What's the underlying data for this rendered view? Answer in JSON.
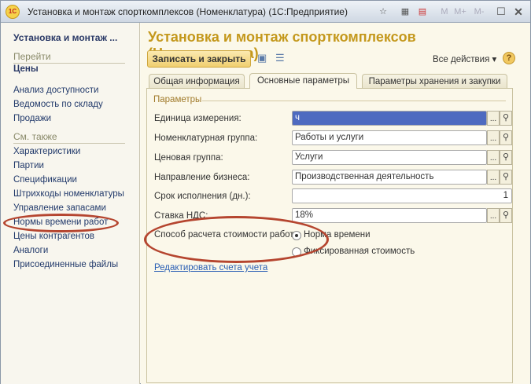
{
  "window": {
    "title": "Установка и монтаж спорткомплексов (Номенклатура)  (1С:Предприятие)",
    "logo": "1С",
    "toolbar": [
      "M",
      "M+",
      "M-"
    ]
  },
  "sidebar": {
    "title": "Установка и монтаж ...",
    "goto_label": "Перейти",
    "goto_current": "Цены",
    "goto_items": [
      "Анализ доступности",
      "Ведомость по складу",
      "Продажи"
    ],
    "see_also_label": "См. также",
    "see_also_items": [
      "Характеристики",
      "Партии",
      "Спецификации",
      "Штрихкоды номенклатуры",
      "Управление запасами",
      "Нормы времени работ",
      "Цены контрагентов",
      "Аналоги",
      "Присоединенные файлы"
    ]
  },
  "main": {
    "title": "Установка и монтаж спорткомплексов (Номенклатура)",
    "save_close": "Записать и закрыть",
    "all_actions": "Все действия ▾",
    "help": "?",
    "tabs": [
      "Общая информация",
      "Основные параметры",
      "Параметры хранения и закупки"
    ],
    "group": "Параметры",
    "fields": [
      {
        "label": "Единица измерения:",
        "value": "ч"
      },
      {
        "label": "Номенклатурная группа:",
        "value": "Работы и услуги"
      },
      {
        "label": "Ценовая группа:",
        "value": "Услуги"
      },
      {
        "label": "Направление бизнеса:",
        "value": "Производственная деятельность"
      },
      {
        "label": "Срок исполнения (дн.):",
        "value": "1"
      },
      {
        "label": "Ставка НДС:",
        "value": "18%"
      }
    ],
    "calc_label": "Способ расчета стоимости работ:",
    "calc_options": [
      "Норма времени",
      "Фиксированная стоимость"
    ],
    "calc_selected": 0,
    "link": "Редактировать счета учета",
    "btn_dots": "...",
    "btn_search": "⚲"
  },
  "colors": {
    "accent": "#c4981c",
    "highlight": "#b5452f"
  }
}
